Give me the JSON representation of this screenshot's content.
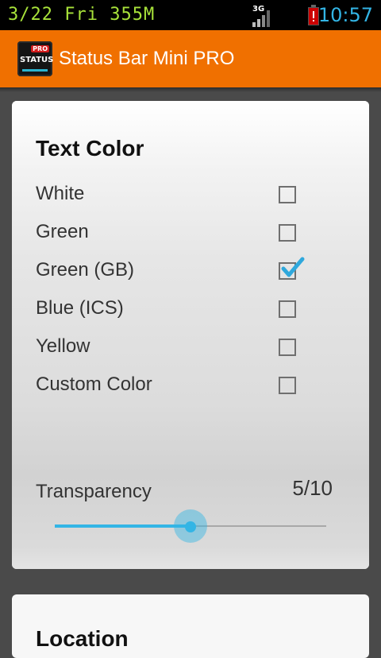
{
  "status_bar": {
    "left_text": "3/22  Fri  355M",
    "network_label": "3G",
    "time": "10:57"
  },
  "action_bar": {
    "icon_badge": "PRO",
    "icon_text": "STATUS",
    "title": "Status Bar Mini PRO",
    "background": "#f07000"
  },
  "text_color_section": {
    "title": "Text Color",
    "options": [
      {
        "label": "White",
        "checked": false
      },
      {
        "label": "Green",
        "checked": false
      },
      {
        "label": "Green (GB)",
        "checked": true
      },
      {
        "label": "Blue (ICS)",
        "checked": false
      },
      {
        "label": "Yellow",
        "checked": false
      },
      {
        "label": "Custom Color",
        "checked": false
      }
    ]
  },
  "transparency": {
    "label": "Transparency",
    "value_text": "5/10",
    "value": 5,
    "max": 10
  },
  "next_section": {
    "title": "Location"
  },
  "colors": {
    "accent": "#33b5e5",
    "status_green": "#a8e23a",
    "action_bar": "#f07000"
  }
}
